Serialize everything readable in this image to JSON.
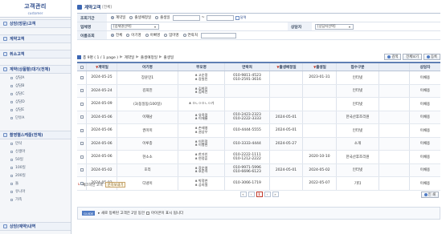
{
  "app": {
    "title": "고객관리",
    "subtitle": "customer"
  },
  "sidebar": {
    "groups": [
      {
        "label": "상담(방문)고객",
        "items": []
      },
      {
        "label": "계약고객",
        "items": []
      },
      {
        "label": "취소고객",
        "items": []
      },
      {
        "label": "계약(상품별)대기(전체)",
        "items": [
          "상담A",
          "상담B",
          "상담C",
          "상담D",
          "상담E",
          "단유A"
        ]
      },
      {
        "label": "촬영별스케줄(전체)",
        "items": [
          "만삭",
          "신생아",
          "50일",
          "100일",
          "200일",
          "돌",
          "유니아",
          "가족"
        ]
      },
      {
        "label": "상담(예약)내역",
        "items": []
      }
    ]
  },
  "header": {
    "title": "계약고객",
    "mode": "[전체]"
  },
  "filters": {
    "date_label": "조회기간",
    "date_options": [
      "계약일",
      "출생예정일",
      "출생일"
    ],
    "date_range_sep": "~",
    "calendar_label": "달력",
    "partner_label": "업체명",
    "partner_value": "[업체명선택]",
    "manager_label": "상담자",
    "manager_value": "[상담자선택]",
    "name_label": "이름조회",
    "name_options": [
      "전체",
      "아기명",
      "아빠명",
      "엄마명",
      "연락처"
    ]
  },
  "toolbar": {
    "count_text": "총 9명 ( 1 / 1 page )",
    "links": [
      "계약일",
      "출생예정일",
      "출생일"
    ],
    "search_btn": "검색",
    "viewall_btn": "전체보기",
    "register_btn": "등록"
  },
  "grid": {
    "headers": [
      "계약일",
      "아기명",
      "부모명",
      "연락처",
      "출생예정일",
      "출생일",
      "접수구분",
      "상담자"
    ],
    "rows": [
      {
        "date": "2024-05-25",
        "baby": "장윤민1",
        "parents": [
          "고순정",
          "장원민"
        ],
        "tel": [
          "010-9811-4523",
          "010-2591-3616"
        ],
        "due": "",
        "birth": "2023-01-31",
        "source": "인터넷",
        "status": "",
        "mgr": "이채용"
      },
      {
        "date": "2024-05-24",
        "baby": "김희진",
        "parents": [
          "김희진",
          "김희진"
        ],
        "tel": [],
        "due": "",
        "birth": "",
        "source": "인터넷",
        "status": "",
        "mgr": "이채용"
      },
      {
        "date": "2024-05-09",
        "baby": "(3)동일동(100일)",
        "parents": [
          "ㅁㄴㅇㅁㄴㅇ가"
        ],
        "tel": [],
        "due": "",
        "birth": "",
        "source": "인터넷",
        "status": "",
        "mgr": "이채용"
      },
      {
        "date": "2024-05-06",
        "baby": "이재남",
        "parents": [
          "유욱정",
          "이재룡"
        ],
        "tel": [
          "010-2423-2323",
          "010-2222-3333"
        ],
        "due": "2024-05-01",
        "birth": "",
        "source": "한국산후조리원",
        "status": "",
        "mgr": "이채용"
      },
      {
        "date": "2024-05-06",
        "baby": "권미미",
        "parents": [
          "손태영",
          "권상우"
        ],
        "tel": [
          "010-4444-5555"
        ],
        "due": "2024-05-01",
        "birth": "",
        "source": "인터넷",
        "status": "",
        "mgr": "이채용"
      },
      {
        "date": "2024-05-06",
        "baby": "이루종",
        "parents": [
          "이민정",
          "이병헌"
        ],
        "tel": [
          "010-3333-4444"
        ],
        "due": "2024-05-27",
        "birth": "",
        "source": "소개",
        "status": "",
        "mgr": "이채용"
      },
      {
        "date": "2024-05-06",
        "baby": "현소소",
        "parents": [
          "한가인",
          "연정훈"
        ],
        "tel": [
          "010-2222-1111",
          "010-1212-2222"
        ],
        "due": "",
        "birth": "2020-10-10",
        "source": "한국산후조리원",
        "status": "",
        "mgr": "이채용"
      },
      {
        "date": "2024-05-02",
        "baby": "호리",
        "parents": [
          "장순영",
          "호준아"
        ],
        "tel": [
          "010-9971-5996",
          "010-6696-6123"
        ],
        "due": "2024-05-01",
        "birth": "2024-05-02",
        "source": "인터넷",
        "status": "",
        "mgr": "이채용"
      },
      {
        "date": "2024-05-02",
        "baby": "디냉이",
        "parents": [
          "박정연",
          "공지철"
        ],
        "tel": [
          "010-3066-1719"
        ],
        "due": "",
        "birth": "2022-05-07",
        "source": "기타",
        "status": "",
        "mgr": "이채용"
      }
    ]
  },
  "below_grid": {
    "check_label": "체크하신 고객",
    "message_btn": "문자보내기"
  },
  "pager": {
    "first": "«",
    "prev": "‹",
    "current": "1",
    "next": "›",
    "last": "»"
  },
  "bottom": {
    "print_btn": "인 쇄"
  },
  "guide": {
    "tag": "GUIDE",
    "text": "새로 등록된 고객은 2일 동안",
    "text_after": "아이콘이 표시 됩니다"
  }
}
